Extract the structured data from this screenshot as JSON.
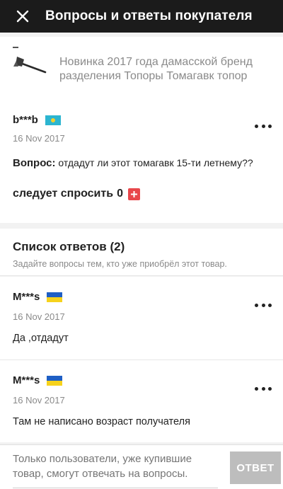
{
  "header": {
    "title": "Вопросы и ответы покупателя",
    "close_icon": "close-icon"
  },
  "product": {
    "title": "Новинка 2017 года дамасской бренд разделения Топоры Томагавк топор",
    "thumbnail_icon": "axe-image"
  },
  "question": {
    "username": "b***b",
    "flag": "kazakhstan-flag",
    "date": "16 Nov 2017",
    "label": "Вопрос:",
    "text": "отдадут ли этот томагавк 15-ти летнему??",
    "ask_label": "следует спросить",
    "ask_count": "0",
    "more_icon": "more-dots-icon"
  },
  "answers_section": {
    "title": "Список ответов (2)",
    "subtitle": "Задайте вопросы тем, кто уже приобрёл этот товар."
  },
  "answers": [
    {
      "username": "M***s",
      "flag": "ukraine-flag",
      "date": "16 Nov 2017",
      "text": "Да ,отдадут"
    },
    {
      "username": "M***s",
      "flag": "ukraine-flag",
      "date": "16 Nov 2017",
      "text": "Там не написано возраст получателя"
    }
  ],
  "footer": {
    "placeholder": "Только пользователи, уже купившие товар, смогут отвечать на вопросы.",
    "send_label": "ОТВЕТ"
  },
  "colors": {
    "topbar": "#1b1b1b",
    "plus_button": "#e8474b",
    "send_button": "#bdbdbd",
    "muted_text": "#8a8a8a"
  }
}
